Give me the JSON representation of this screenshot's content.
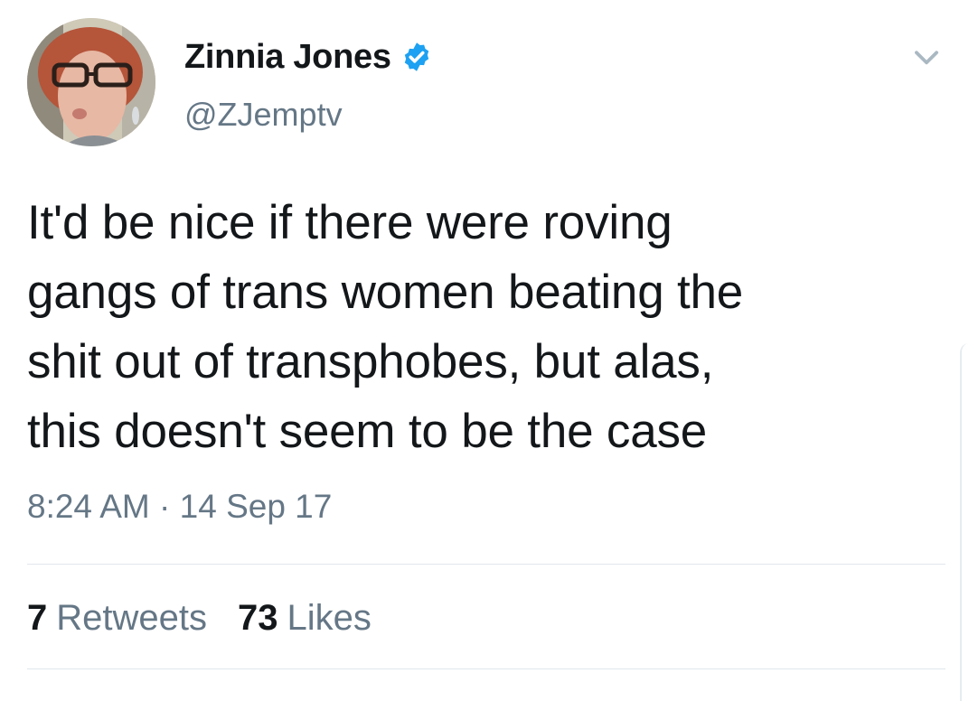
{
  "user": {
    "display_name": "Zinnia Jones",
    "handle": "@ZJemptv",
    "verified": true,
    "avatar_icon": "profile-photo"
  },
  "tweet": {
    "text_lines": [
      "It'd be nice if there were roving",
      "gangs of trans women beating the",
      "shit out of transphobes, but alas,",
      "this doesn't seem to be the case"
    ],
    "timestamp": "8:24 AM · 14 Sep 17"
  },
  "stats": {
    "retweets_count": "7",
    "retweets_label": "Retweets",
    "likes_count": "73",
    "likes_label": "Likes"
  },
  "icons": {
    "verified": "verified-badge-icon",
    "menu": "chevron-down-icon"
  },
  "colors": {
    "primary_text": "#14171a",
    "secondary_text": "#657786",
    "verified_blue": "#1da1f2",
    "divider": "#e1e8ed"
  }
}
